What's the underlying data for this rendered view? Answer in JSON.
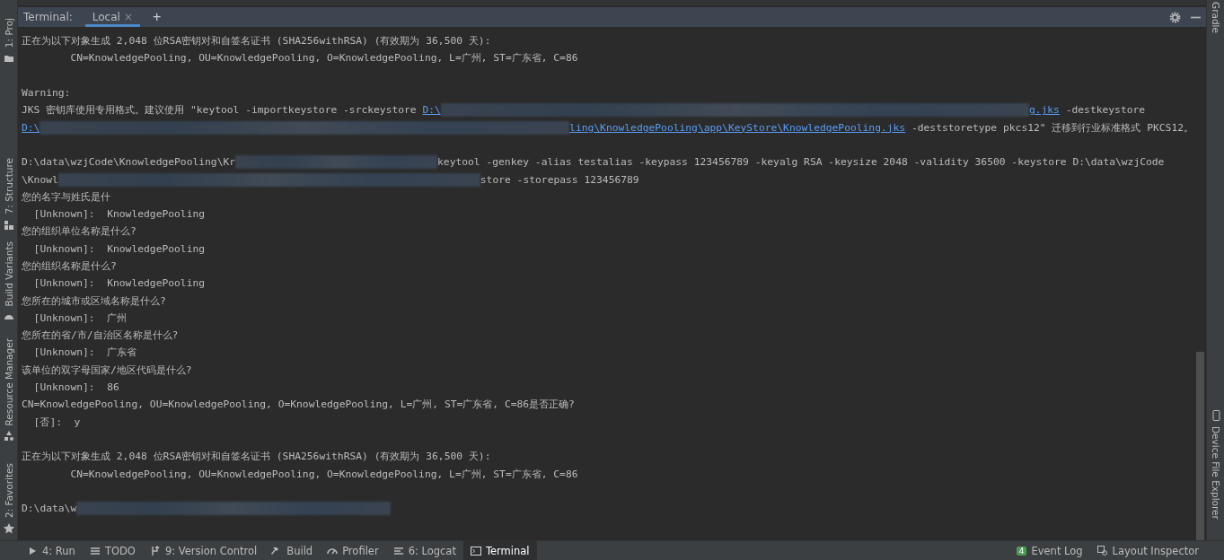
{
  "left_stripe": [
    {
      "label": "1: Proj"
    },
    {
      "label": "7: Structure"
    },
    {
      "label": "Build Variants"
    },
    {
      "label": "Resource Manager"
    },
    {
      "label": "2: Favorites"
    }
  ],
  "right_stripe": [
    {
      "label": "Gradle"
    },
    {
      "label": "Device File Explorer"
    }
  ],
  "terminal": {
    "title": "Terminal:",
    "tabs": [
      {
        "label": "Local",
        "selected": true,
        "close": "×"
      }
    ],
    "add": "+",
    "lines": [
      {
        "kind": "text",
        "segments": [
          {
            "kind": "text",
            "text": "正在为以下对象生成 2,048 位RSA密钥对和自签名证书 (SHA256withRSA) (有效期为 36,500 天):"
          }
        ]
      },
      {
        "kind": "text",
        "segments": [
          {
            "kind": "text",
            "text": "        CN=KnowledgePooling, OU=KnowledgePooling, O=KnowledgePooling, L=广州, ST=广东省, C=86"
          }
        ]
      },
      {
        "kind": "blank"
      },
      {
        "kind": "text",
        "segments": [
          {
            "kind": "text",
            "text": "Warning:"
          }
        ]
      },
      {
        "kind": "text",
        "segments": [
          {
            "kind": "text",
            "text": "JKS 密钥库使用专用格式。建议使用 \"keytool -importkeystore -srckeystore "
          },
          {
            "kind": "link",
            "text": "D:\\"
          },
          {
            "kind": "redacted"
          },
          {
            "kind": "link",
            "text": "g.jks"
          },
          {
            "kind": "text",
            "text": " -destkeystore"
          }
        ]
      },
      {
        "kind": "text",
        "segments": [
          {
            "kind": "link",
            "text": "D:\\"
          },
          {
            "kind": "redacted"
          },
          {
            "kind": "link",
            "text": "ling\\KnowledgePooling\\app\\KeyStore\\KnowledgePooling.jks"
          },
          {
            "kind": "text",
            "text": " -deststoretype pkcs12\" 迁移到行业标准格式 PKCS12。"
          }
        ]
      },
      {
        "kind": "blank"
      },
      {
        "kind": "text",
        "segments": [
          {
            "kind": "text",
            "text": "D:\\data\\wzjCode\\KnowledgePooling\\Kr"
          },
          {
            "kind": "redacted"
          },
          {
            "kind": "text",
            "text": "keytool -genkey -alias testalias -keypass 123456789 -keyalg RSA -keysize 2048 -validity 36500 -keystore D:\\data\\wzjCode"
          }
        ]
      },
      {
        "kind": "text",
        "segments": [
          {
            "kind": "text",
            "text": "\\Knowl"
          },
          {
            "kind": "redacted"
          },
          {
            "kind": "text",
            "text": "store -storepass 123456789"
          }
        ]
      },
      {
        "kind": "text",
        "segments": [
          {
            "kind": "text",
            "text": "您的名字与姓氏是什"
          }
        ]
      },
      {
        "kind": "text",
        "segments": [
          {
            "kind": "text",
            "text": "  [Unknown]:  KnowledgePooling"
          }
        ]
      },
      {
        "kind": "text",
        "segments": [
          {
            "kind": "text",
            "text": "您的组织单位名称是什么?"
          }
        ]
      },
      {
        "kind": "text",
        "segments": [
          {
            "kind": "text",
            "text": "  [Unknown]:  KnowledgePooling"
          }
        ]
      },
      {
        "kind": "text",
        "segments": [
          {
            "kind": "text",
            "text": "您的组织名称是什么?"
          }
        ]
      },
      {
        "kind": "text",
        "segments": [
          {
            "kind": "text",
            "text": "  [Unknown]:  KnowledgePooling"
          }
        ]
      },
      {
        "kind": "text",
        "segments": [
          {
            "kind": "text",
            "text": "您所在的城市或区域名称是什么?"
          }
        ]
      },
      {
        "kind": "text",
        "segments": [
          {
            "kind": "text",
            "text": "  [Unknown]:  广州"
          }
        ]
      },
      {
        "kind": "text",
        "segments": [
          {
            "kind": "text",
            "text": "您所在的省/市/自治区名称是什么?"
          }
        ]
      },
      {
        "kind": "text",
        "segments": [
          {
            "kind": "text",
            "text": "  [Unknown]:  广东省"
          }
        ]
      },
      {
        "kind": "text",
        "segments": [
          {
            "kind": "text",
            "text": "该单位的双字母国家/地区代码是什么?"
          }
        ]
      },
      {
        "kind": "text",
        "segments": [
          {
            "kind": "text",
            "text": "  [Unknown]:  86"
          }
        ]
      },
      {
        "kind": "text",
        "segments": [
          {
            "kind": "text",
            "text": "CN=KnowledgePooling, OU=KnowledgePooling, O=KnowledgePooling, L=广州, ST=广东省, C=86是否正确?"
          }
        ]
      },
      {
        "kind": "text",
        "segments": [
          {
            "kind": "text",
            "text": "  [否]:  y"
          }
        ]
      },
      {
        "kind": "blank"
      },
      {
        "kind": "text",
        "segments": [
          {
            "kind": "text",
            "text": "正在为以下对象生成 2,048 位RSA密钥对和自签名证书 (SHA256withRSA) (有效期为 36,500 天):"
          }
        ]
      },
      {
        "kind": "text",
        "segments": [
          {
            "kind": "text",
            "text": "        CN=KnowledgePooling, OU=KnowledgePooling, O=KnowledgePooling, L=广州, ST=广东省, C=86"
          }
        ]
      },
      {
        "kind": "blank"
      },
      {
        "kind": "text",
        "segments": [
          {
            "kind": "text",
            "text": "D:\\data\\w"
          },
          {
            "kind": "redacted"
          }
        ]
      }
    ]
  },
  "bottom_tabs": [
    {
      "label": "4: Run",
      "selected": false
    },
    {
      "label": "TODO",
      "selected": false
    },
    {
      "label": "9: Version Control",
      "selected": false
    },
    {
      "label": "Build",
      "selected": false
    },
    {
      "label": "Profiler",
      "selected": false
    },
    {
      "label": "6: Logcat",
      "selected": false
    },
    {
      "label": "Terminal",
      "selected": true
    }
  ],
  "bottom_right": [
    {
      "label": "Event Log",
      "badge": "4"
    },
    {
      "label": "Layout Inspector"
    }
  ]
}
